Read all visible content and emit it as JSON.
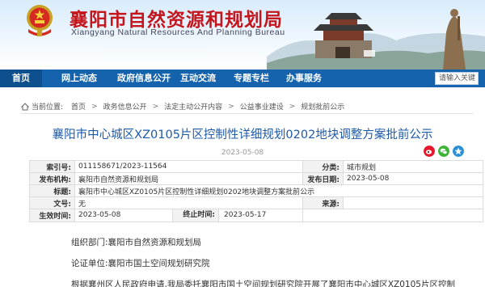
{
  "header": {
    "title": "襄阳市自然资源和规划局",
    "subtitle": "Xiangyang Natural Resources And Planning Bureau"
  },
  "nav": {
    "items": [
      {
        "label": "首页"
      },
      {
        "label": "网上动态"
      },
      {
        "label": "政府信息公开"
      },
      {
        "label": "互动交流"
      },
      {
        "label": "专题专栏"
      },
      {
        "label": "办事服务"
      }
    ],
    "search_placeholder": "请输入关键"
  },
  "breadcrumb": {
    "prefix": "当前位置:",
    "items": [
      "首页",
      "政务信息公开",
      "法定主动公开内容",
      "公益事业建设",
      "规划批前公示"
    ]
  },
  "article": {
    "title": "襄阳市中心城区XZ0105片区控制性详细规划0202地块调整方案批前公示",
    "date": "2023-05-08"
  },
  "meta": {
    "index_label": "索引号:",
    "index_value": "011158671/2023-11564",
    "category_label": "分类:",
    "category_value": "城市规划",
    "publisher_label": "发布机构:",
    "publisher_value": "襄阳市自然资源和规划局",
    "publish_date_label": "发布日期:",
    "publish_date_value": "2023-05-08",
    "subject_label": "标题:",
    "subject_value": "襄阳市中心城区XZ0105片区控制性详细规划0202地块调整方案批前公示",
    "docno_label": "文号:",
    "docno_value": "无",
    "source_label": "来源:",
    "source_value": "",
    "effective_label": "生效时间:",
    "effective_value": "2023-05-08",
    "expiry_label": "终止时间:",
    "expiry_value": "2023-05-17"
  },
  "body": {
    "org": "组织部门:襄阳市自然资源和规划局",
    "unit": "论证单位:襄阳市国土空间规划研究院",
    "text": "根据襄州区人民政府申请,我局委托襄阳市国土空间规划研究院开展了襄阳市中心城区XZ0105片区控制"
  },
  "colors": {
    "brand_red": "#c4161c",
    "nav_blue": "#1563ad",
    "title_blue": "#1d5aa8"
  },
  "icons": [
    "emblem-icon",
    "home-icon",
    "weibo-icon",
    "wechat-icon",
    "qzone-icon"
  ]
}
